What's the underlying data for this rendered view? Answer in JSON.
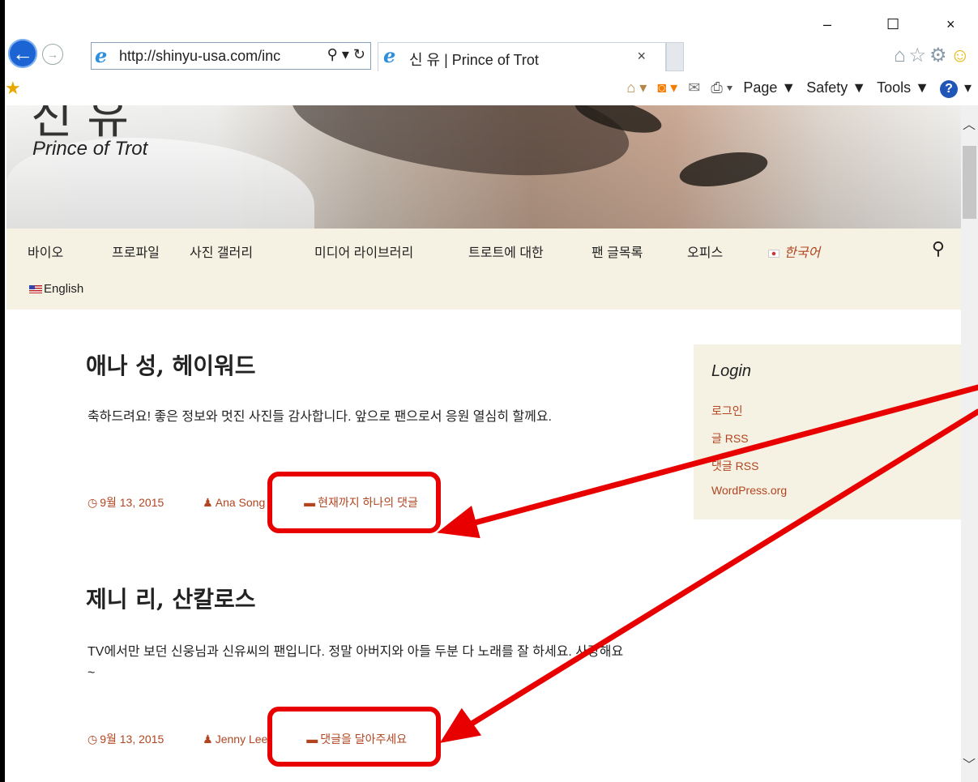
{
  "window": {
    "minimize": "–",
    "maximize": "☐",
    "close": "×"
  },
  "browser": {
    "url": "http://shinyu-usa.com/inc",
    "search_glyph": "⚲",
    "dropdown_glyph": "▾",
    "refresh_glyph": "↻",
    "tab_title": "신 유 | Prince of Trot",
    "tab_close": "×",
    "commands": {
      "page": "Page ▼",
      "safety": "Safety ▼",
      "tools": "Tools ▼",
      "help": "?"
    }
  },
  "site": {
    "title_korean": "신 유",
    "tagline": "Prince of Trot"
  },
  "nav": {
    "items": [
      "바이오",
      "프로파일",
      "사진 갤러리",
      "미디어 라이브러리",
      "트로트에 대한",
      "팬 글목록",
      "오피스"
    ],
    "lang_korean": "한국어",
    "lang_english": "English"
  },
  "posts": [
    {
      "title": "애나 성, 헤이워드",
      "body": "축하드려요! 좋은 정보와 멋진 사진들 감사합니다. 앞으로 팬으로서 응원 열심히 할께요.",
      "date": "9월 13, 2015",
      "author": "Ana Song",
      "comments": "현재까지 하나의 댓글"
    },
    {
      "title": "제니 리, 산칼로스",
      "body": "TV에서만 보던 신웅님과 신유씨의 팬입니다. 정말 아버지와 아들 두분 다 노래를 잘 하세요. 사랑해요~",
      "date": "9월 13, 2015",
      "author": "Jenny Lee",
      "comments": "댓글을 달아주세요"
    }
  ],
  "sidebar": {
    "heading": "Login",
    "links": [
      "로그인",
      "글 RSS",
      "댓글 RSS",
      "WordPress.org"
    ]
  },
  "colors": {
    "accent": "#b24520",
    "nav_bg": "#f5f1e3",
    "annotation": "#e80000"
  }
}
